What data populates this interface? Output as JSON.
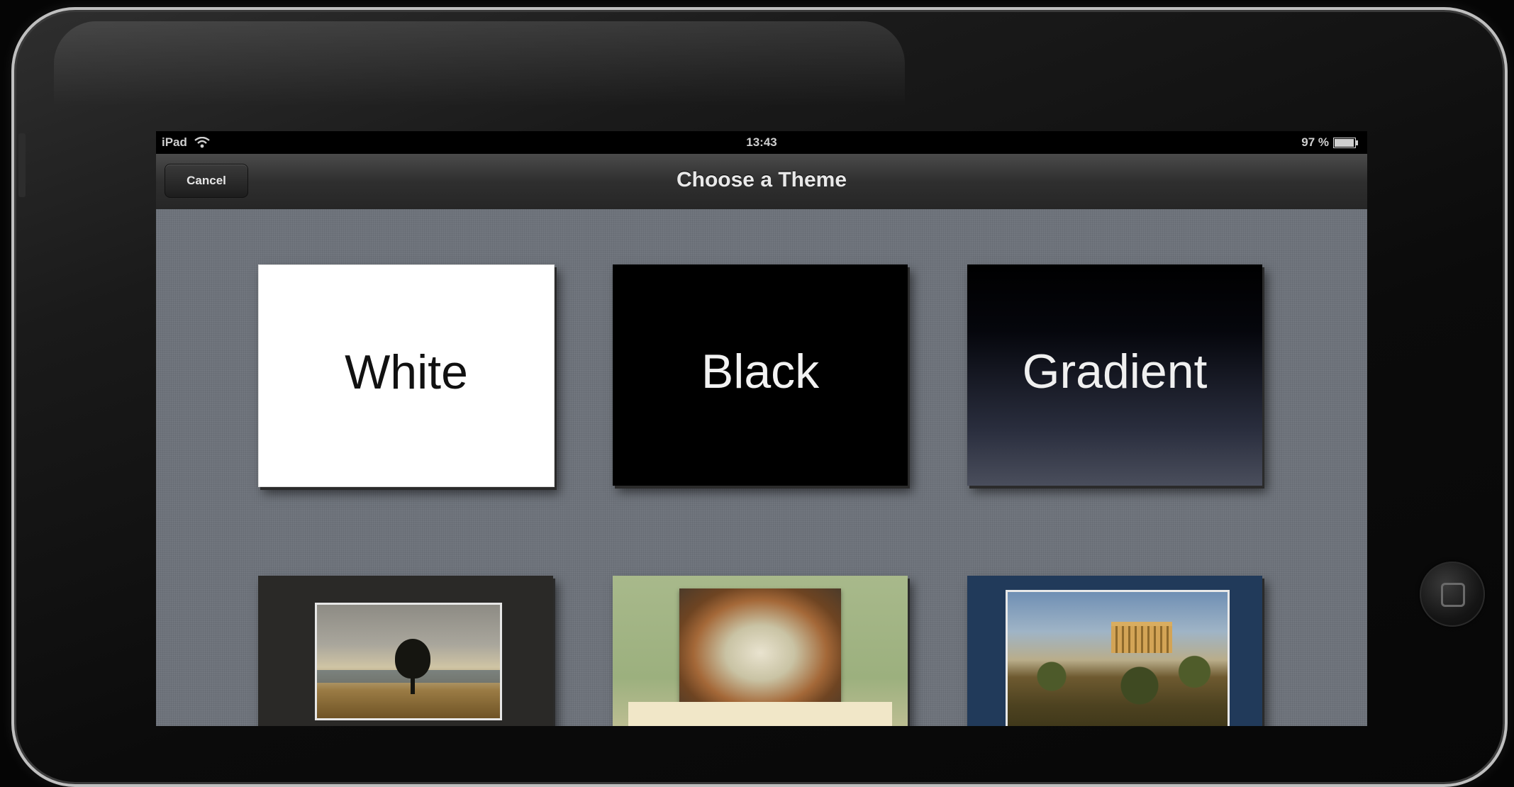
{
  "status_bar": {
    "carrier": "iPad",
    "time": "13:43",
    "battery": "97 %"
  },
  "nav_bar": {
    "title": "Choose a Theme",
    "cancel_label": "Cancel"
  },
  "themes": [
    {
      "label": "White"
    },
    {
      "label": "Black"
    },
    {
      "label": "Gradient"
    },
    {
      "label": ""
    },
    {
      "label": ""
    },
    {
      "label": ""
    }
  ],
  "colors": {
    "nav_bar": "#2f2f2f",
    "background_linen": "#6e737b",
    "status_text": "#cfcfcf"
  }
}
